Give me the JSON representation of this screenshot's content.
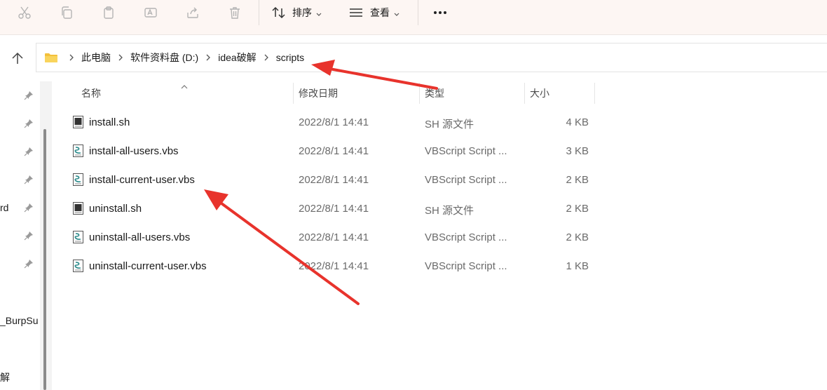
{
  "toolbar": {
    "icons": [
      "cut-icon",
      "copy-icon",
      "paste-icon",
      "rename-icon",
      "share-icon",
      "delete-icon"
    ],
    "sort_label": "排序",
    "view_label": "查看",
    "more_icon": "more-icon"
  },
  "address": {
    "crumbs": [
      "此电脑",
      "软件资料盘 (D:)",
      "idea破解",
      "scripts"
    ]
  },
  "nav": {
    "partial_labels": [
      "rd",
      "_BurpSu",
      "解"
    ]
  },
  "columns": {
    "name": "名称",
    "modified": "修改日期",
    "type": "类型",
    "size": "大小"
  },
  "files": [
    {
      "name": "install.sh",
      "modified": "2022/8/1 14:41",
      "type": "SH 源文件",
      "size": "4 KB",
      "icon": "shell-script-icon"
    },
    {
      "name": "install-all-users.vbs",
      "modified": "2022/8/1 14:41",
      "type": "VBScript Script ...",
      "size": "3 KB",
      "icon": "vbscript-icon"
    },
    {
      "name": "install-current-user.vbs",
      "modified": "2022/8/1 14:41",
      "type": "VBScript Script ...",
      "size": "2 KB",
      "icon": "vbscript-icon"
    },
    {
      "name": "uninstall.sh",
      "modified": "2022/8/1 14:41",
      "type": "SH 源文件",
      "size": "2 KB",
      "icon": "shell-script-icon"
    },
    {
      "name": "uninstall-all-users.vbs",
      "modified": "2022/8/1 14:41",
      "type": "VBScript Script ...",
      "size": "2 KB",
      "icon": "vbscript-icon"
    },
    {
      "name": "uninstall-current-user.vbs",
      "modified": "2022/8/1 14:41",
      "type": "VBScript Script ...",
      "size": "1 KB",
      "icon": "vbscript-icon"
    }
  ],
  "colors": {
    "toolbar_bg": "#fdf6f3",
    "annotation_arrow": "#e8332c",
    "folder": "#f3c03b"
  }
}
